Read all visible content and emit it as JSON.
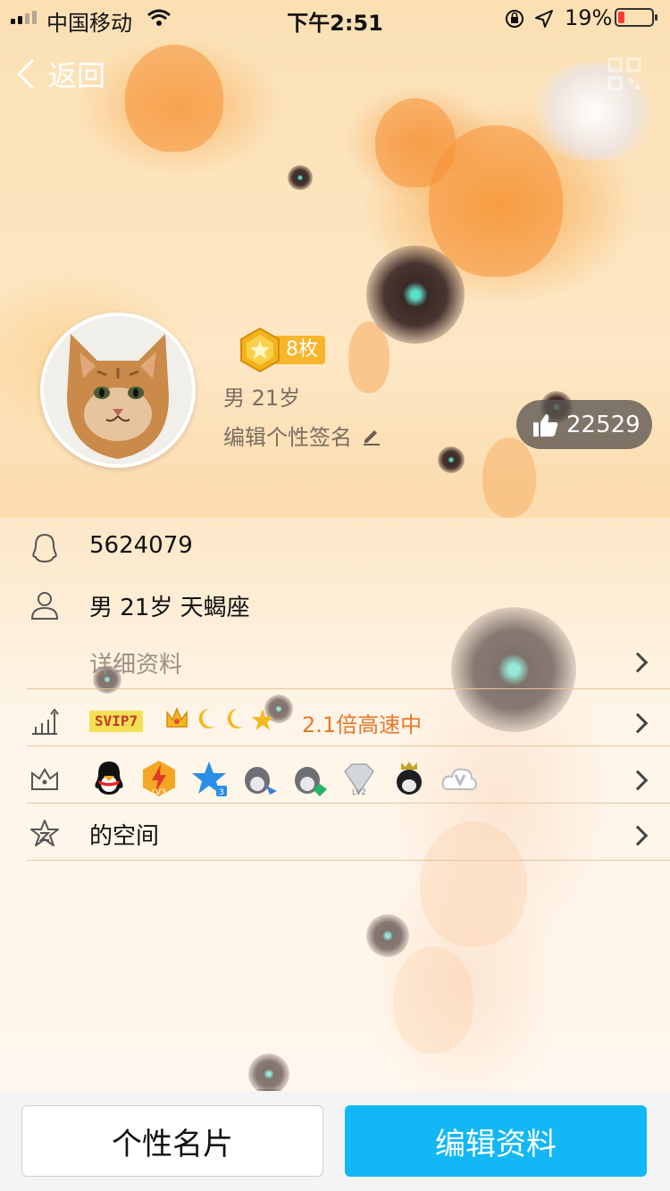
{
  "status_bar": {
    "carrier": "中国移动",
    "time": "下午2:51",
    "battery_percent": "19%",
    "battery_level": 0.19,
    "battery_color": "#ff3b30"
  },
  "nav": {
    "back_label": "返回",
    "icons": {
      "qr": "qr-code-icon"
    }
  },
  "profile": {
    "medal_count": "8枚",
    "gender_age": "男  21岁",
    "signature_placeholder": "编辑个性签名",
    "likes": "22529"
  },
  "info": {
    "qq_number": "5624079",
    "details": "男 21岁 天蝎座",
    "more_details": "详细资料",
    "svip_badge": "SVIP7",
    "speed_text": "2.1倍高速中",
    "space_label": "的空间"
  },
  "vip_icons": [
    "crown-icon",
    "moon-icon",
    "moon-icon",
    "star-icon"
  ],
  "game_icons": [
    "qq-penguin-icon",
    "lv3-lightning-icon",
    "blue-star-icon",
    "penguin-rocket-icon",
    "penguin-gem-icon",
    "diamond-lv2-icon",
    "penguin-crown-icon",
    "qq-v-cloud-icon"
  ],
  "buttons": {
    "card": "个性名片",
    "edit": "编辑资料"
  },
  "colors": {
    "accent_blue": "#12b7f5",
    "speed_orange": "#e8782a",
    "medal_gold": "#f7b52a"
  }
}
